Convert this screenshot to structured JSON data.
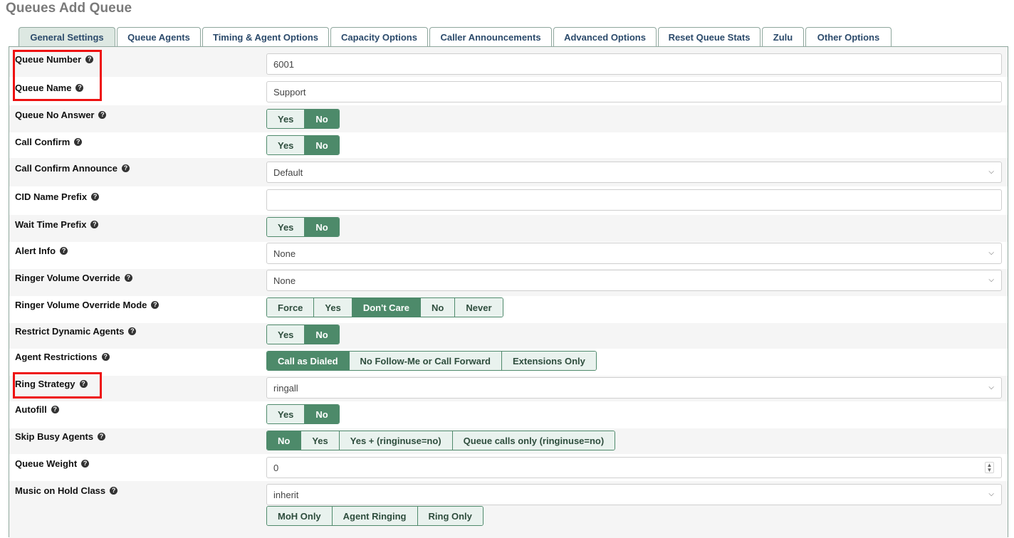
{
  "page": {
    "title": "Queues Add Queue"
  },
  "tabs": [
    {
      "label": "General Settings",
      "active": true
    },
    {
      "label": "Queue Agents",
      "active": false
    },
    {
      "label": "Timing & Agent Options",
      "active": false
    },
    {
      "label": "Capacity Options",
      "active": false
    },
    {
      "label": "Caller Announcements",
      "active": false
    },
    {
      "label": "Advanced Options",
      "active": false
    },
    {
      "label": "Reset Queue Stats",
      "active": false
    },
    {
      "label": "Zulu",
      "active": false
    },
    {
      "label": "Other Options",
      "active": false
    }
  ],
  "fields": {
    "queue_number": {
      "label": "Queue Number",
      "value": "6001"
    },
    "queue_name": {
      "label": "Queue Name",
      "value": "Support"
    },
    "queue_no_answer": {
      "label": "Queue No Answer",
      "options": [
        "Yes",
        "No"
      ],
      "selected": "No"
    },
    "call_confirm": {
      "label": "Call Confirm",
      "options": [
        "Yes",
        "No"
      ],
      "selected": "No"
    },
    "call_confirm_announce": {
      "label": "Call Confirm Announce",
      "value": "Default"
    },
    "cid_name_prefix": {
      "label": "CID Name Prefix",
      "value": ""
    },
    "wait_time_prefix": {
      "label": "Wait Time Prefix",
      "options": [
        "Yes",
        "No"
      ],
      "selected": "No"
    },
    "alert_info": {
      "label": "Alert Info",
      "value": "None"
    },
    "ringer_volume_override": {
      "label": "Ringer Volume Override",
      "value": "None"
    },
    "ringer_volume_override_mode": {
      "label": "Ringer Volume Override Mode",
      "options": [
        "Force",
        "Yes",
        "Don't Care",
        "No",
        "Never"
      ],
      "selected": "Don't Care"
    },
    "restrict_dynamic_agents": {
      "label": "Restrict Dynamic Agents",
      "options": [
        "Yes",
        "No"
      ],
      "selected": "No"
    },
    "agent_restrictions": {
      "label": "Agent Restrictions",
      "options": [
        "Call as Dialed",
        "No Follow-Me or Call Forward",
        "Extensions Only"
      ],
      "selected": "Call as Dialed"
    },
    "ring_strategy": {
      "label": "Ring Strategy",
      "value": "ringall"
    },
    "autofill": {
      "label": "Autofill",
      "options": [
        "Yes",
        "No"
      ],
      "selected": "No"
    },
    "skip_busy_agents": {
      "label": "Skip Busy Agents",
      "options": [
        "No",
        "Yes",
        "Yes + (ringinuse=no)",
        "Queue calls only (ringinuse=no)"
      ],
      "selected": "No"
    },
    "queue_weight": {
      "label": "Queue Weight",
      "value": "0"
    },
    "music_on_hold_class": {
      "label": "Music on Hold Class",
      "value": "inherit",
      "mode_options": [
        "MoH Only",
        "Agent Ringing",
        "Ring Only"
      ]
    }
  },
  "icons": {
    "help": "question-circle-icon",
    "dropdown": "chevron-down-icon",
    "spinner": "spinner-icon"
  },
  "colors": {
    "accent": "#4d8a6a",
    "tab_active_bg": "#dde8e2",
    "highlight": "#ee1111"
  },
  "glyphs": {
    "help": "?",
    "chevron": "⌵",
    "spin_up": "▲",
    "spin_down": "▼"
  }
}
